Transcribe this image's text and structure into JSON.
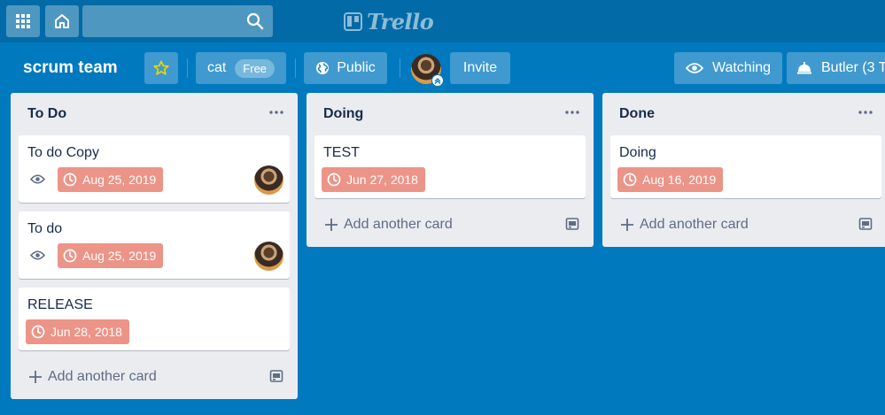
{
  "topbar": {
    "search": {
      "value": "",
      "placeholder": ""
    },
    "logo_text": "Trello"
  },
  "board": {
    "title": "scrum team",
    "team_label": "cat",
    "team_badge": "Free",
    "visibility_label": "Public",
    "invite_label": "Invite",
    "watching_label": "Watching",
    "butler_label": "Butler (3 T"
  },
  "lists": [
    {
      "title": "To Do",
      "cards": [
        {
          "title": "To do Copy",
          "due": "Aug 25, 2019",
          "watching": true,
          "has_member": true
        },
        {
          "title": "To do",
          "due": "Aug 25, 2019",
          "watching": true,
          "has_member": true
        },
        {
          "title": "RELEASE",
          "due": "Jun 28, 2018",
          "watching": false,
          "has_member": false
        }
      ],
      "add_card_label": "Add another card"
    },
    {
      "title": "Doing",
      "cards": [
        {
          "title": "TEST",
          "due": "Jun 27, 2018",
          "watching": false,
          "has_member": false
        }
      ],
      "add_card_label": "Add another card"
    },
    {
      "title": "Done",
      "cards": [
        {
          "title": "Doing",
          "due": "Aug 16, 2019",
          "watching": false,
          "has_member": false
        }
      ],
      "add_card_label": "Add another card"
    }
  ],
  "colors": {
    "board_bg": "#0079bf",
    "topbar_bg": "#026aa7",
    "list_bg": "#ebecf0",
    "due_badge_bg": "#ec9488",
    "star": "#f2d600"
  },
  "icons": {
    "apps": "apps-grid-icon",
    "home": "home-icon",
    "search": "search-icon",
    "logo": "trello-board-icon",
    "star": "star-icon",
    "globe": "globe-icon",
    "eye": "eye-icon",
    "butler": "butler-bell-icon",
    "menu": "more-horizontal-icon",
    "clock": "clock-icon",
    "plus": "plus-icon",
    "template": "card-template-icon"
  }
}
